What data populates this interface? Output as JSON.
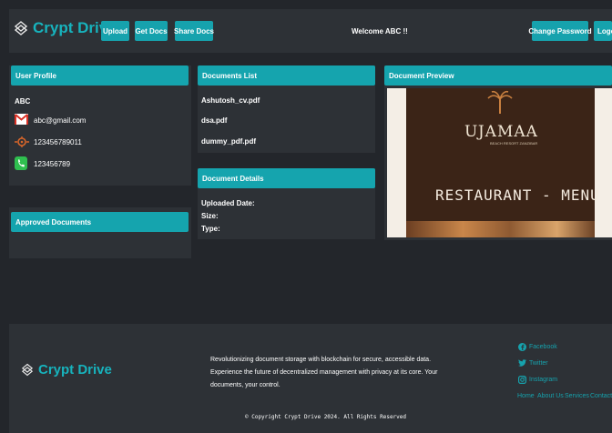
{
  "header": {
    "brand": "Crypt Drive",
    "buttons": {
      "upload": "Upload",
      "get_docs": "Get Docs",
      "share_docs": "Share Docs"
    },
    "welcome": "Welcome ABC !!",
    "change_password": "Change Password",
    "logout": "Logou"
  },
  "profile": {
    "title": "User Profile",
    "name": "ABC",
    "email": "abc@gmail.com",
    "id_number": "123456789011",
    "phone": "123456789"
  },
  "approved": {
    "title": "Approved Documents"
  },
  "documents": {
    "title": "Documents List",
    "items": [
      "Ashutosh_cv.pdf",
      "dsa.pdf",
      "dummy_pdf.pdf"
    ]
  },
  "details": {
    "title": "Document Details",
    "uploaded": "Uploaded Date:",
    "size": "Size:",
    "type": "Type:"
  },
  "preview": {
    "title": "Document Preview",
    "logo_text": "UJAMAA",
    "logo_sub": "BEACH RESORT ZANZIBAR",
    "menu_title": "RESTAURANT - MENU"
  },
  "footer": {
    "brand": "Crypt Drive",
    "tagline_1": "Revolutionizing document storage with blockchain for secure, accessible data.",
    "tagline_2": "Experience the future of decentralized management with privacy at its core. Your",
    "tagline_3": "documents, your control.",
    "copyright": "© Copyright Crypt Drive 2024. All Rights Reserved",
    "social": [
      "Facebook",
      "Twitter",
      "Instagram"
    ],
    "links": [
      "Home",
      "About Us",
      "Services",
      "Contact Us"
    ]
  },
  "colors": {
    "accent": "#16a2ad",
    "panel": "#2d3136",
    "background": "#23262b"
  }
}
